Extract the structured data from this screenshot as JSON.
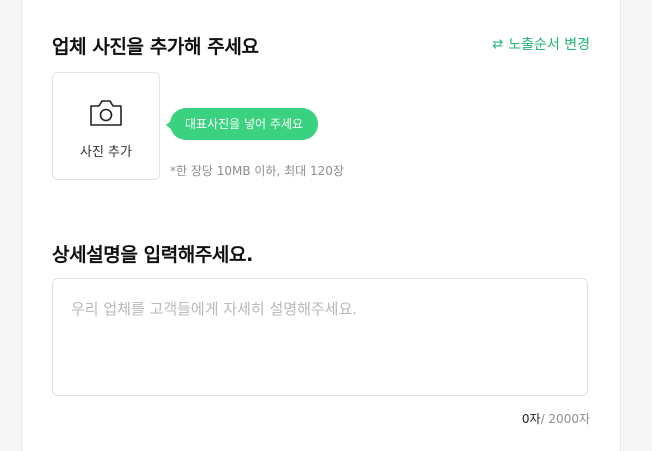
{
  "photos": {
    "title": "업체 사진을 추가해 주세요",
    "reorder_label": "노출순서 변경",
    "add_button_label": "사진 추가",
    "tooltip": "대표사진을 넣어 주세요",
    "limit_text": "*한 장당 10MB 이하, 최대 120장"
  },
  "description": {
    "title": "상세설명을 입력해주세요.",
    "placeholder": "우리 업체를 고객들에게 자세히 설명해주세요.",
    "value": "",
    "count_current": "0자",
    "count_max": "/ 2000자"
  },
  "colors": {
    "accent": "#22b573",
    "tooltip_bg": "#3ad17f"
  },
  "icons": {
    "reorder": "swap-arrows-icon",
    "add_photo": "camera-icon"
  }
}
